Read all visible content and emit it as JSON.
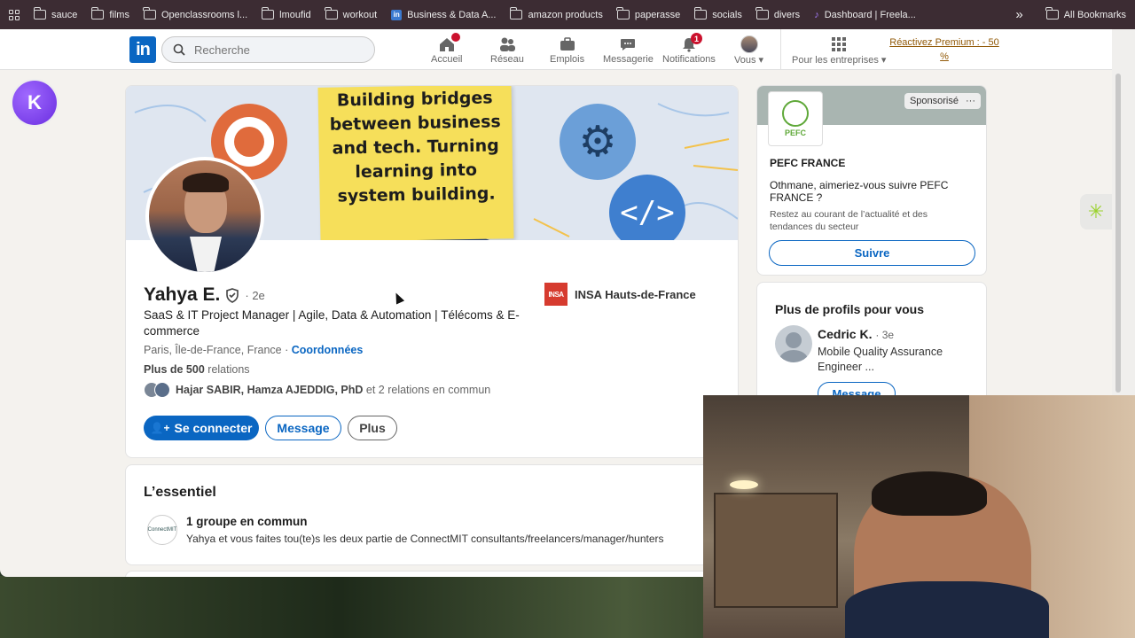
{
  "bookmarks": {
    "items": [
      {
        "label": "sauce",
        "type": "folder"
      },
      {
        "label": "films",
        "type": "folder"
      },
      {
        "label": "Openclassrooms l...",
        "type": "folder"
      },
      {
        "label": "lmoufid",
        "type": "folder"
      },
      {
        "label": "workout",
        "type": "folder"
      },
      {
        "label": "Business & Data A...",
        "type": "linkedin"
      },
      {
        "label": "amazon products",
        "type": "folder"
      },
      {
        "label": "paperasse",
        "type": "folder"
      },
      {
        "label": "socials",
        "type": "folder"
      },
      {
        "label": "divers",
        "type": "folder"
      },
      {
        "label": "Dashboard | Freela...",
        "type": "link"
      }
    ],
    "more": "»",
    "all_bookmarks": "All Bookmarks"
  },
  "nav": {
    "logo": "in",
    "search_placeholder": "Recherche",
    "items": [
      {
        "label": "Accueil",
        "badge": ""
      },
      {
        "label": "Réseau",
        "badge": ""
      },
      {
        "label": "Emplois",
        "badge": ""
      },
      {
        "label": "Messagerie",
        "badge": ""
      },
      {
        "label": "Notifications",
        "badge": "1"
      },
      {
        "label": "Vous",
        "badge": ""
      },
      {
        "label": "Pour les entreprises",
        "badge": ""
      }
    ],
    "premium": "Réactivez Premium : - 50 %"
  },
  "kapp": {
    "letter": "K"
  },
  "profile": {
    "banner_text": "Building bridges between business and tech. Turning learning into system building.",
    "name": "Yahya E.",
    "degree": "· 2e",
    "headline": "SaaS & IT Project Manager | Agile, Data & Automation | Télécoms & E-commerce",
    "location": "Paris, Île-de-France, France ·",
    "contact_link": "Coordonnées",
    "relations": "Plus de 500 relations",
    "relations_bold": "Plus de 500",
    "relations_rest": "relations",
    "mutual_names": "Hajar SABIR, Hamza AJEDDIG, PhD",
    "mutual_rest": "et 2 relations en commun",
    "school_logo": "INSA",
    "school": "INSA Hauts-de-France",
    "buttons": {
      "connect": "Se connecter",
      "message": "Message",
      "more": "Plus"
    }
  },
  "essentiel": {
    "title": "L’essentiel",
    "group_logo": "ConnectMIT",
    "group_title": "1 groupe en commun",
    "group_desc": "Yahya et vous faites tou(te)s les deux partie de ConnectMIT consultants/freelancers/manager/hunters"
  },
  "ad": {
    "logo": "PEFC",
    "sponsored": "Sponsorisé",
    "more": "···",
    "name": "PEFC FRANCE",
    "question": "Othmane, aimeriez-vous suivre PEFC FRANCE ?",
    "desc": "Restez au courant de l’actualité et des tendances du secteur",
    "follow": "Suivre"
  },
  "more_profiles": {
    "title": "Plus de profils pour vous",
    "person": {
      "name": "Cedric K.",
      "degree": "· 3e",
      "headline": "Mobile Quality Assurance Engineer ...",
      "button": "Message"
    }
  },
  "side_widget": "✳"
}
